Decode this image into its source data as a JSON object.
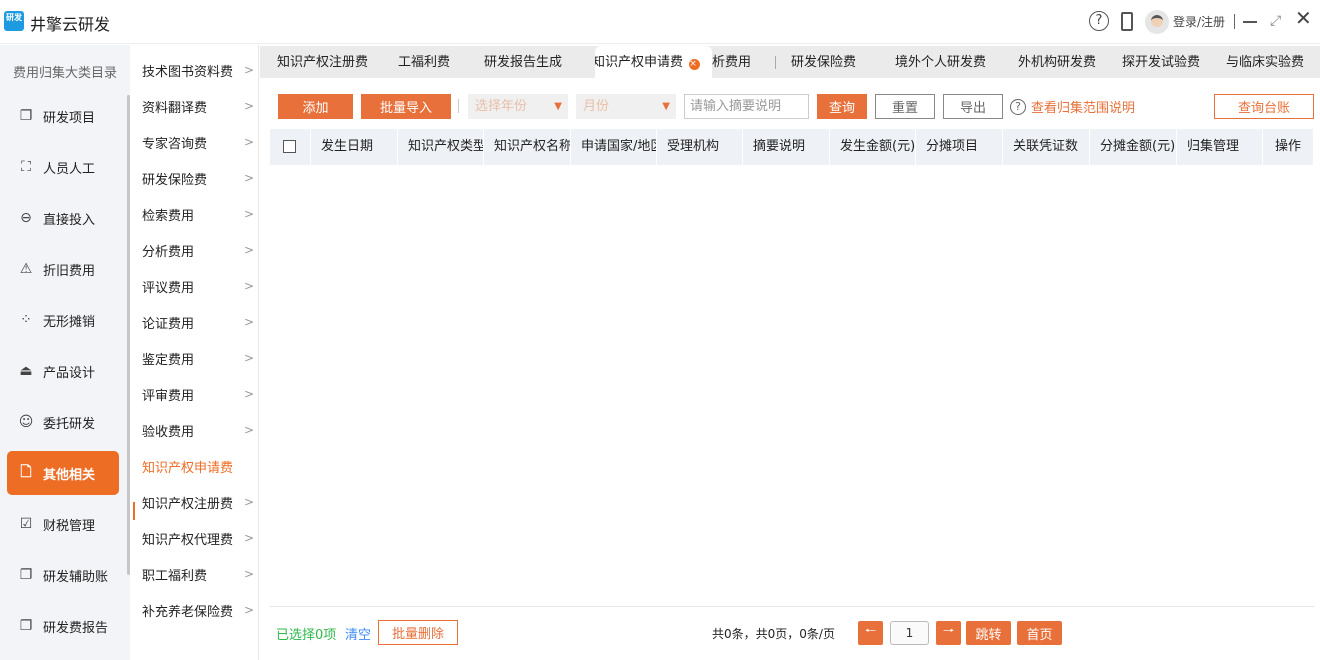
{
  "app": {
    "logo_text": "研发",
    "title": "井擎云研发",
    "login": "登录/注册"
  },
  "icons": {
    "help": "help-circle-icon",
    "mobile": "mobile-icon",
    "avatar": "avatar",
    "minimize": "minimize-icon",
    "maximize": "maximize-icon",
    "close": "close-icon"
  },
  "colors": {
    "accent": "#e8703a",
    "sidebar_bg": "#f3f4f8",
    "selected_count": "#2fb84a",
    "clear_link": "#3d8bf2"
  },
  "sidebar": {
    "title": "费用归集大类目录",
    "items": [
      {
        "label": "研发项目",
        "icon": "copy-icon"
      },
      {
        "label": "人员人工",
        "icon": "user-scan-icon"
      },
      {
        "label": "直接投入",
        "icon": "login-circle-icon"
      },
      {
        "label": "折旧费用",
        "icon": "alert-calendar-icon"
      },
      {
        "label": "无形摊销",
        "icon": "grid-circles-icon"
      },
      {
        "label": "产品设计",
        "icon": "stamp-icon"
      },
      {
        "label": "委托研发",
        "icon": "user-handshake-icon"
      },
      {
        "label": "其他相关",
        "icon": "document-icon",
        "active": true
      },
      {
        "label": "财税管理",
        "icon": "clipboard-check-icon"
      },
      {
        "label": "研发辅助账",
        "icon": "copy-icon"
      },
      {
        "label": "研发费报告",
        "icon": "copy-icon"
      }
    ]
  },
  "submenu": {
    "items": [
      {
        "label": "技术图书资料费"
      },
      {
        "label": "资料翻译费"
      },
      {
        "label": "专家咨询费"
      },
      {
        "label": "研发保险费"
      },
      {
        "label": "检索费用"
      },
      {
        "label": "分析费用"
      },
      {
        "label": "评议费用"
      },
      {
        "label": "论证费用"
      },
      {
        "label": "鉴定费用"
      },
      {
        "label": "评审费用"
      },
      {
        "label": "验收费用"
      },
      {
        "label": "知识产权申请费",
        "active": true
      },
      {
        "label": "知识产权注册费"
      },
      {
        "label": "知识产权代理费"
      },
      {
        "label": "职工福利费"
      },
      {
        "label": "补充养老保险费"
      }
    ]
  },
  "tabs": [
    {
      "label": "知识产权注册费"
    },
    {
      "label": "工福利费"
    },
    {
      "label": "研发报告生成"
    },
    {
      "label": "知识产权申请费",
      "active": true
    },
    {
      "label": "析费用"
    },
    {
      "label": "研发保险费"
    },
    {
      "label": "境外个人研发费"
    },
    {
      "label": "外机构研发费"
    },
    {
      "label": "探开发试验费"
    },
    {
      "label": "与临床实验费"
    }
  ],
  "toolbar": {
    "add": "添加",
    "batch_import": "批量导入",
    "year_placeholder": "选择年份",
    "month_placeholder": "月份",
    "search_placeholder": "请输入摘要说明",
    "search_value": "",
    "query": "查询",
    "reset": "重置",
    "export": "导出",
    "scope_help": "查看归集范围说明",
    "ledger": "查询台账"
  },
  "table": {
    "columns": [
      "发生日期",
      "知识产权类型",
      "知识产权名称",
      "申请国家/地区",
      "受理机构",
      "摘要说明",
      "发生金额(元)",
      "分摊项目",
      "关联凭证数",
      "分摊金额(元)",
      "归集管理",
      "操作"
    ],
    "rows": []
  },
  "footer": {
    "selected": "已选择0项",
    "clear": "清空",
    "batch_delete": "批量删除",
    "summary": "共0条，共0页，0条/页",
    "page": "1",
    "jump": "跳转",
    "first": "首页"
  }
}
